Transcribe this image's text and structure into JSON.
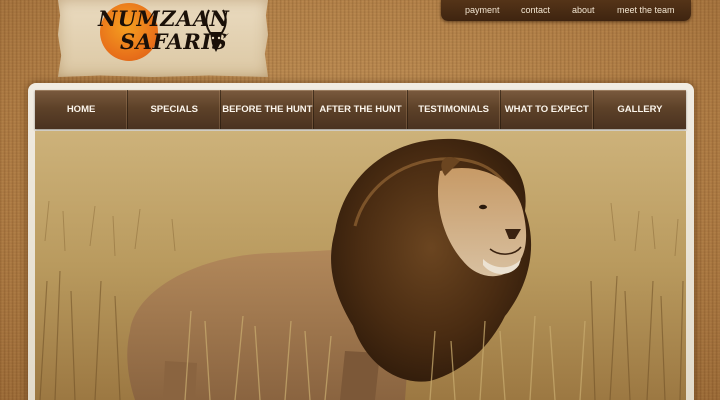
{
  "logo": {
    "line1": "NUMZAAN",
    "line2": "SAFARIS"
  },
  "top_nav": {
    "items": [
      "payment",
      "contact",
      "about",
      "meet the team"
    ]
  },
  "main_nav": {
    "items": [
      "HOME",
      "SPECIALS",
      "BEFORE THE HUNT",
      "AFTER THE HUNT",
      "TESTIMONIALS",
      "WHAT TO EXPECT",
      "GALLERY"
    ]
  },
  "colors": {
    "background": "#b9874d",
    "nav_bar": "#5e4229",
    "top_nav": "#3e2410",
    "logo_sun": "#e8701a"
  },
  "hero": {
    "icon": "lion-photo"
  }
}
